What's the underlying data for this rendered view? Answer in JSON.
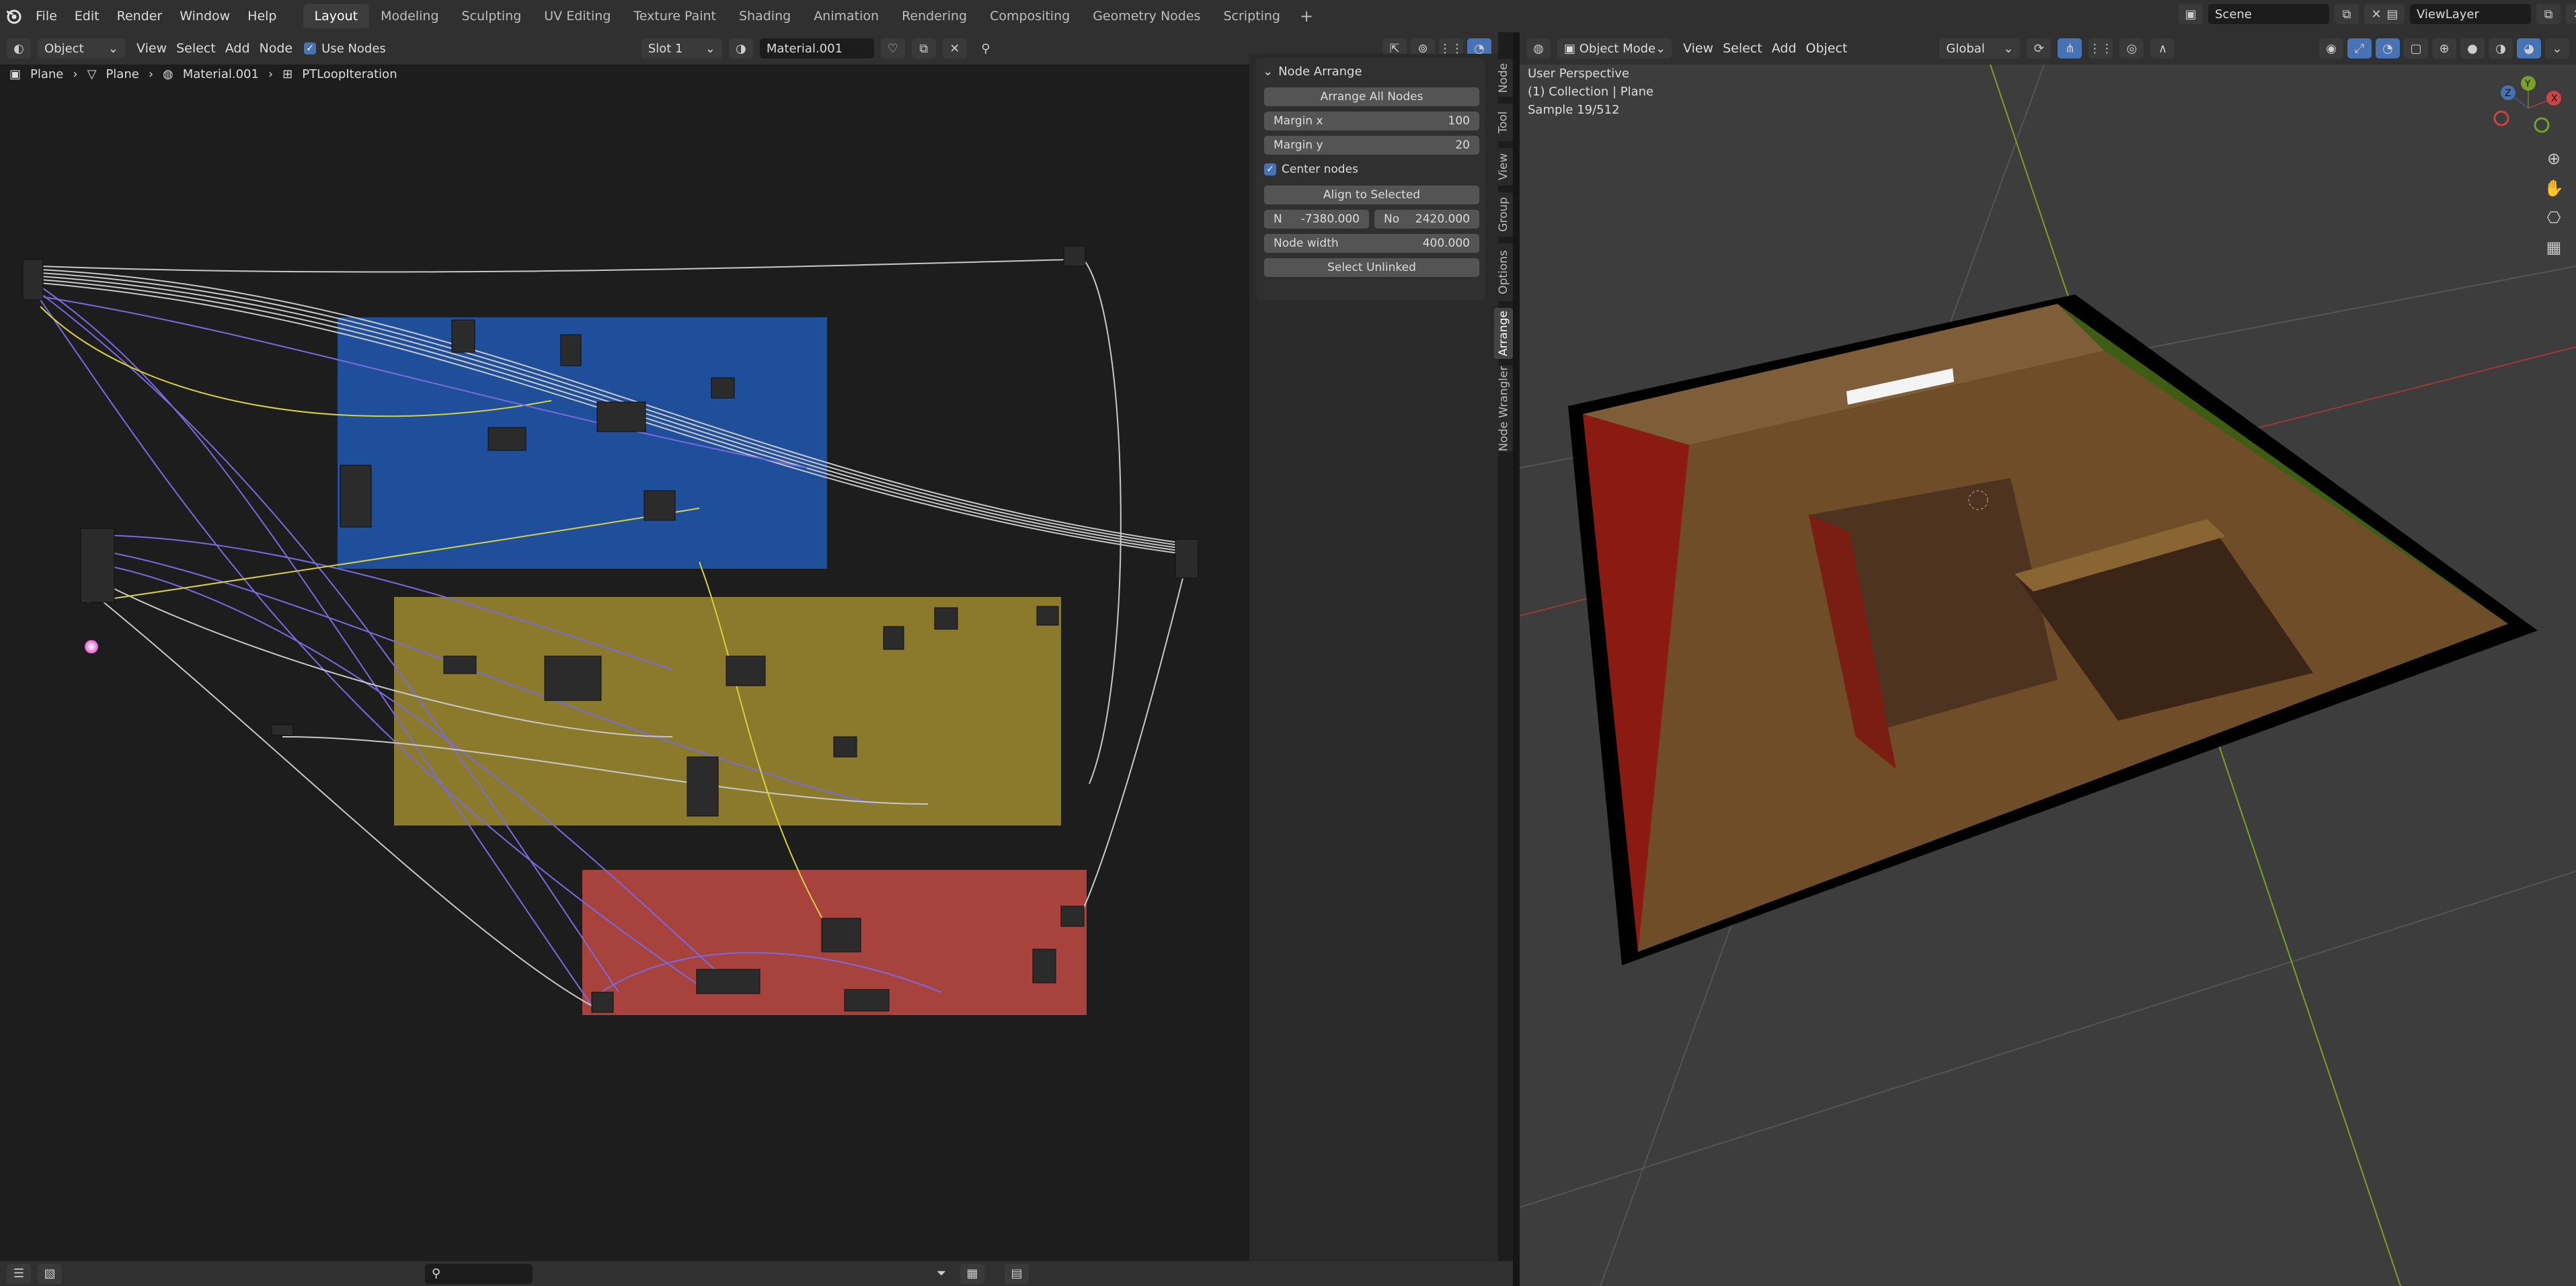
{
  "topbar": {
    "menus": [
      "File",
      "Edit",
      "Render",
      "Window",
      "Help"
    ],
    "workspaces": [
      "Layout",
      "Modeling",
      "Sculpting",
      "UV Editing",
      "Texture Paint",
      "Shading",
      "Animation",
      "Rendering",
      "Compositing",
      "Geometry Nodes",
      "Scripting"
    ],
    "active_workspace": "Layout",
    "plus": "+",
    "scene": "Scene",
    "view_layer": "ViewLayer"
  },
  "node_editor": {
    "header": {
      "mode": "Object",
      "menus": [
        "View",
        "Select",
        "Add",
        "Node"
      ],
      "use_nodes": "Use Nodes",
      "check": "✓",
      "slot": "Slot 1",
      "material": "Material.001"
    },
    "breadcrumb": [
      "Plane",
      "Plane",
      "Material.001",
      "PTLoopIteration"
    ],
    "sidebar": {
      "title": "Node Arrange",
      "arrange_all": "Arrange All Nodes",
      "margin_x_label": "Margin x",
      "margin_x": "100",
      "margin_y_label": "Margin y",
      "margin_y": "20",
      "center_nodes": "Center nodes",
      "align_selected": "Align to Selected",
      "n_label": "N",
      "n_value": "-7380.000",
      "no_label": "No",
      "no_value": "2420.000",
      "node_width_label": "Node width",
      "node_width": "400.000",
      "select_unlinked": "Select Unlinked",
      "tabs": [
        "Node",
        "Tool",
        "View",
        "Group",
        "Options",
        "Arrange",
        "Node Wrangler"
      ],
      "active_tab": "Arrange"
    }
  },
  "viewport": {
    "header": {
      "mode": "Object Mode",
      "menus": [
        "View",
        "Select",
        "Add",
        "Object"
      ],
      "orientation": "Global"
    },
    "overlay": {
      "perspective": "User Perspective",
      "collection": "(1) Collection | Plane",
      "sample": "Sample 19/512"
    },
    "gizmo": {
      "x": "X",
      "y": "Y",
      "z": "Z"
    },
    "colors": {
      "left_wall": "#8a1a12",
      "right_wall": "#3d5e12",
      "floor": "#6e4d28",
      "back_wall": "#7d5e38"
    }
  },
  "frames": {
    "blue": "#1f4f9a",
    "yellow": "#8c7a2c",
    "red": "#a8423d"
  },
  "icons": {
    "blender": "blender-logo-icon",
    "search": "search-icon",
    "filter": "filter-icon"
  }
}
